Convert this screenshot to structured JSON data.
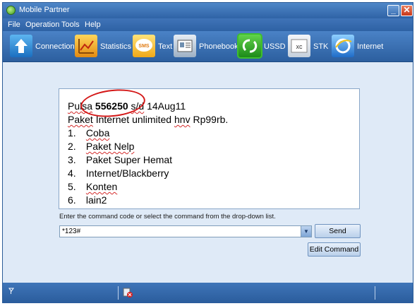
{
  "window": {
    "title": "Mobile Partner"
  },
  "menu": [
    "File",
    "Operation",
    "Tools",
    "Help"
  ],
  "toolbar": {
    "items": [
      {
        "label": "Connection",
        "icon": "connection-icon",
        "color": "#2c8fd8"
      },
      {
        "label": "Statistics",
        "icon": "statistics-icon",
        "color": "#e9a21a"
      },
      {
        "label": "Text",
        "icon": "sms-icon",
        "color": "#f0b81c"
      },
      {
        "label": "Phonebook",
        "icon": "phonebook-icon",
        "color": "#7f93aa"
      },
      {
        "label": "USSD",
        "icon": "ussd-icon",
        "color": "#2fa52a"
      },
      {
        "label": "STK",
        "icon": "stk-icon",
        "color": "#d9e1ea"
      },
      {
        "label": "Internet",
        "icon": "internet-icon",
        "color": "#2b86d6"
      }
    ],
    "active": "USSD"
  },
  "ussd": {
    "response": {
      "line1": {
        "prefix": "Pulsa",
        "amount": "556250",
        "suffix_underlined": "s/d",
        "date": "14Aug11"
      },
      "line2": {
        "underlined": "Paket",
        "rest": "Internet unlimited",
        "underlined2": "hnv",
        "price": "Rp99rb."
      },
      "menu_items": [
        {
          "num": "1.",
          "label": "Coba"
        },
        {
          "num": "2.",
          "label": "Paket Nelp"
        },
        {
          "num": "3.",
          "label": "Paket Super Hemat"
        },
        {
          "num": "4.",
          "label": "Internet/Blackberry"
        },
        {
          "num": "5.",
          "label": "Konten"
        },
        {
          "num": "6.",
          "label": "lain2"
        }
      ]
    },
    "hint": "Enter the command code or select the command from the drop-down list.",
    "command_value": "*123#",
    "send_label": "Send",
    "edit_label": "Edit Command"
  },
  "statusbar": {
    "signal_icon": "signal-icon",
    "sim_icon": "sim-error-icon"
  }
}
